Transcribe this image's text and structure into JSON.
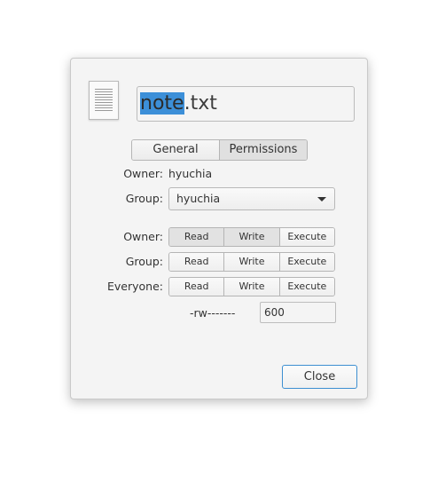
{
  "file": {
    "name_selected": "note",
    "name_rest": ".txt"
  },
  "tabs": [
    {
      "label": "General"
    },
    {
      "label": "Permissions"
    }
  ],
  "owner": {
    "label": "Owner:",
    "value": "hyuchia"
  },
  "group": {
    "label": "Group:",
    "value": "hyuchia"
  },
  "permissions": {
    "rows": [
      {
        "label": "Owner:",
        "read": "Read",
        "write": "Write",
        "execute": "Execute"
      },
      {
        "label": "Group:",
        "read": "Read",
        "write": "Write",
        "execute": "Execute"
      },
      {
        "label": "Everyone:",
        "read": "Read",
        "write": "Write",
        "execute": "Execute"
      }
    ],
    "symbolic": "-rw-------",
    "octal": "600"
  },
  "close_label": "Close",
  "colors": {
    "selection": "#3c8fd8",
    "default_button_border": "#3d8fd1"
  }
}
